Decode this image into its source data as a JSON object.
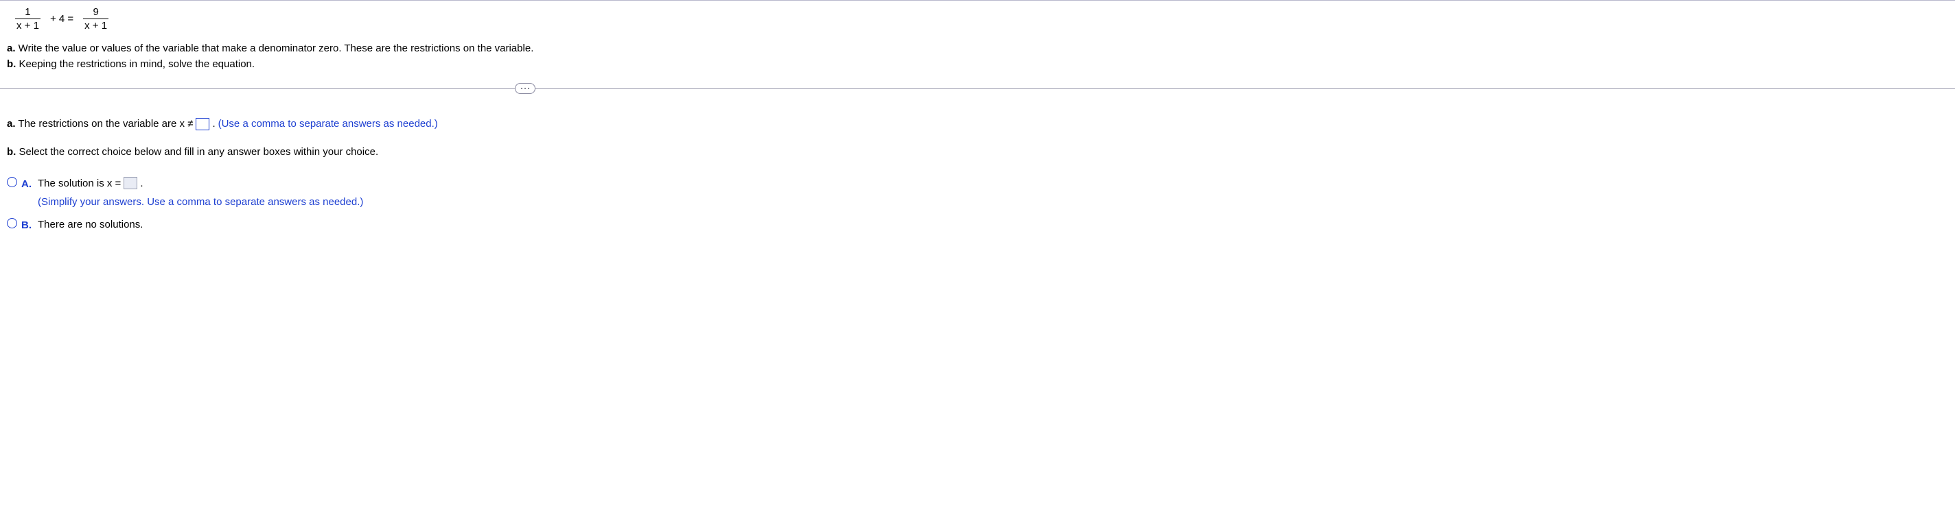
{
  "equation": {
    "frac1_num": "1",
    "frac1_den": "x + 1",
    "mid": "+ 4  =",
    "frac2_num": "9",
    "frac2_den": "x + 1"
  },
  "instructions": {
    "a_label": "a.",
    "a_text": " Write the value or values of the variable that make a denominator zero. These are the restrictions on the variable.",
    "b_label": "b.",
    "b_text": " Keeping the restrictions in mind, solve the equation."
  },
  "part_a": {
    "label": "a.",
    "pre": " The restrictions on the variable are x ≠ ",
    "post": ".",
    "hint": " (Use a comma to separate answers as needed.)"
  },
  "part_b": {
    "label": "b.",
    "text": " Select the correct choice below and fill in any answer boxes within your choice."
  },
  "choices": {
    "A": {
      "letter": "A.",
      "pre": "The solution is x = ",
      "post": ".",
      "hint": "(Simplify your answers. Use a comma to separate answers as needed.)"
    },
    "B": {
      "letter": "B.",
      "text": "There are no solutions."
    }
  }
}
